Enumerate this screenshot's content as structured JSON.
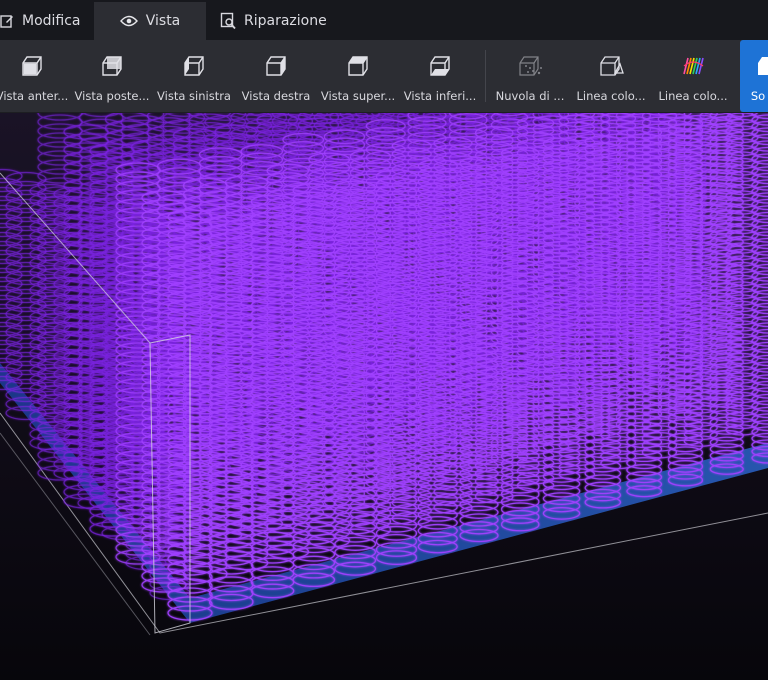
{
  "tabs": [
    {
      "id": "modifica",
      "label": "Modifica",
      "icon": "edit-icon",
      "active": false
    },
    {
      "id": "vista",
      "label": "Vista",
      "icon": "eye-icon",
      "active": true
    },
    {
      "id": "riparazione",
      "label": "Riparazione",
      "icon": "repair-icon",
      "active": false
    }
  ],
  "toolbar": {
    "items": [
      {
        "id": "front",
        "label": "Vista anter...",
        "icon": "cube-front-icon"
      },
      {
        "id": "back",
        "label": "Vista poste...",
        "icon": "cube-back-icon"
      },
      {
        "id": "left",
        "label": "Vista sinistra",
        "icon": "cube-left-icon"
      },
      {
        "id": "right",
        "label": "Vista destra",
        "icon": "cube-right-icon"
      },
      {
        "id": "top",
        "label": "Vista super...",
        "icon": "cube-top-icon"
      },
      {
        "id": "bottom",
        "label": "Vista inferi...",
        "icon": "cube-bottom-icon"
      },
      {
        "id": "cloud",
        "label": "Nuvola di ...",
        "icon": "point-cloud-icon"
      },
      {
        "id": "colorline1",
        "label": "Linea colo...",
        "icon": "color-line-icon"
      },
      {
        "id": "colorline2",
        "label": "Linea colo...",
        "icon": "color-line-multicolor-icon"
      },
      {
        "id": "extra",
        "label": "So",
        "icon": "cube-solid-icon"
      }
    ]
  },
  "colors": {
    "tabbar_bg": "#17181d",
    "toolbar_bg": "#2c2d33",
    "highlight": "#1e73d6",
    "coil": "#a040ff",
    "coil_glow": "#7a22e0",
    "bed": "#1c4aa8",
    "background": "#0d0b14"
  }
}
